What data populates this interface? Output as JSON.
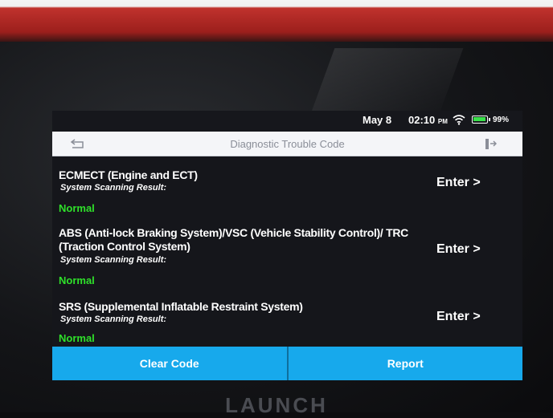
{
  "status_bar": {
    "date": "May 8",
    "time": "02:10",
    "ampm": "PM",
    "battery": "99%"
  },
  "title_bar": {
    "title": "Diagnostic Trouble Code"
  },
  "systems": [
    {
      "name": "ECMECT (Engine and ECT)",
      "result_label": "System Scanning Result:",
      "status": "Normal",
      "action": "Enter >"
    },
    {
      "name": "ABS (Anti-lock Braking System)/VSC (Vehicle Stability Control)/ TRC (Traction Control System)",
      "result_label": "System Scanning Result:",
      "status": "Normal",
      "action": "Enter >"
    },
    {
      "name": "SRS (Supplemental Inflatable Restraint System)",
      "result_label": "System Scanning Result:",
      "status": "Normal",
      "action": "Enter >"
    }
  ],
  "bottom_bar": {
    "clear_label": "Clear Code",
    "report_label": "Report"
  },
  "device": {
    "brand": "LAUNCH"
  },
  "colors": {
    "accent": "#17a9ec",
    "status_normal": "#2fe02a",
    "screen_bg": "#15161b"
  },
  "icons": {
    "back": "back-arrow-icon",
    "exit": "exit-icon",
    "wifi": "wifi-icon",
    "battery": "battery-icon"
  }
}
